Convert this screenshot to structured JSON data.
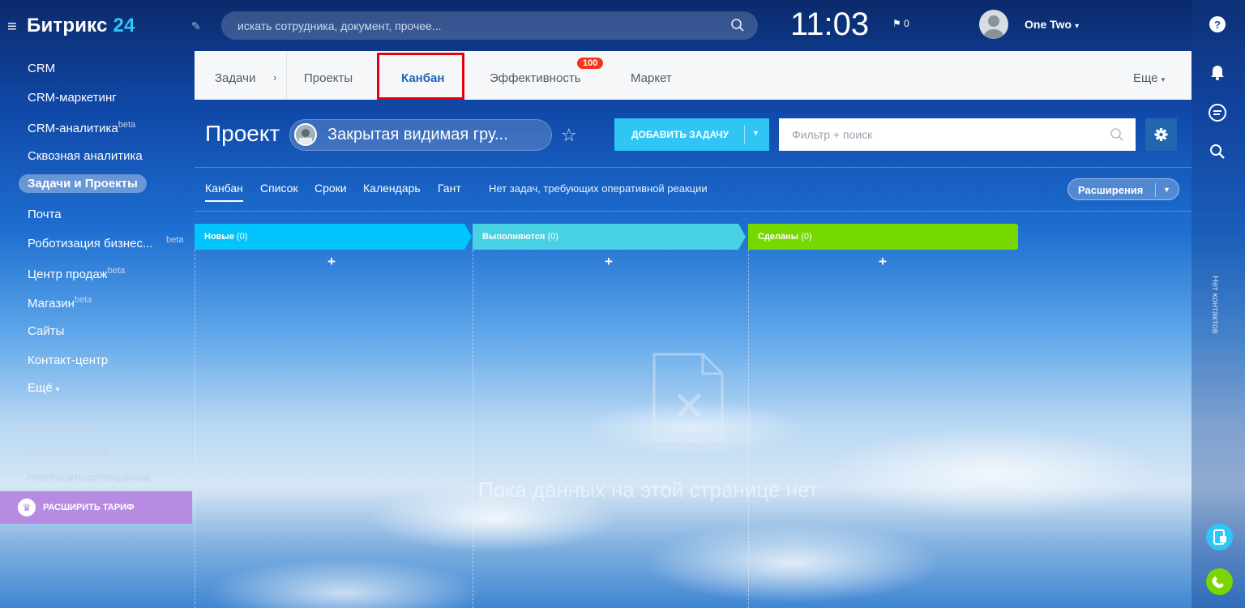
{
  "header": {
    "logo_name": "Битрикс",
    "logo_num": "24",
    "search_placeholder": "искать сотрудника, документ, прочее...",
    "clock": "11:03",
    "flag_count": "0",
    "user_name": "One Two"
  },
  "sidebar": {
    "items": [
      {
        "label": "CRM",
        "beta": ""
      },
      {
        "label": "CRM-маркетинг",
        "beta": ""
      },
      {
        "label": "CRM-аналитика",
        "beta": "beta"
      },
      {
        "label": "Сквозная аналитика",
        "beta": ""
      },
      {
        "label": "Задачи и Проекты",
        "beta": ""
      },
      {
        "label": "Почта",
        "beta": ""
      },
      {
        "label": "Роботизация бизнес...",
        "beta": "beta"
      },
      {
        "label": "Центр продаж",
        "beta": "beta"
      },
      {
        "label": "Магазин",
        "beta": "beta"
      },
      {
        "label": "Сайты",
        "beta": ""
      },
      {
        "label": "Контакт-центр",
        "beta": ""
      },
      {
        "label": "Ещё",
        "beta": ""
      }
    ],
    "small_links": [
      "КАРТА САЙТА",
      "НАСТРОИТЬ МЕНЮ",
      "ПРИГЛАСИТЬ СОТРУДНИКОВ"
    ],
    "upgrade_label": "РАСШИРИТЬ ТАРИФ"
  },
  "tabs": {
    "tasks": "Задачи",
    "projects": "Проекты",
    "kanban": "Канбан",
    "efficiency": "Эффективность",
    "efficiency_badge": "100",
    "market": "Маркет",
    "more": "Еще"
  },
  "project": {
    "title": "Проект",
    "group_name": "Закрытая видимая гру...",
    "add_task": "ДОБАВИТЬ ЗАДАЧУ",
    "filter_placeholder": "Фильтр + поиск"
  },
  "views": {
    "items": [
      "Канбан",
      "Список",
      "Сроки",
      "Календарь",
      "Гант"
    ],
    "notice": "Нет задач, требующих оперативной реакции",
    "extensions": "Расширения"
  },
  "kanban": {
    "columns": [
      {
        "title": "Новые",
        "count": "(0)",
        "color": "#00c4fb"
      },
      {
        "title": "Выполняются",
        "count": "(0)",
        "color": "#47d1e2"
      },
      {
        "title": "Сделаны",
        "count": "(0)",
        "color": "#75d900"
      }
    ],
    "add_symbol": "+",
    "empty_text": "Пока данных на этой странице нет"
  },
  "right_rail": {
    "contacts_label": "Нет контактов"
  },
  "colors": {
    "accent": "#2fc6f6",
    "tab_active": "#2067b0",
    "highlight_border": "#e60012",
    "badge": "#f1361b",
    "upgrade": "#b78be1"
  }
}
